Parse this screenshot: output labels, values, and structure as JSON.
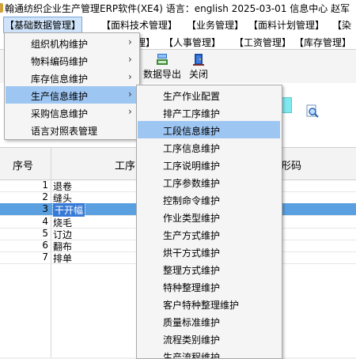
{
  "title": "翰通纺织企业生产管理ERP软件(XE4)  语言：english  2025-03-01  信息中心 赵军",
  "menu_row1": [
    {
      "label": "【基础数据管理】",
      "active": true
    },
    {
      "label": "【面料技术管理】",
      "active": false
    },
    {
      "label": "【业务管理】",
      "active": false
    },
    {
      "label": "【面料计划管理】",
      "active": false
    },
    {
      "label": "【染",
      "active": false
    }
  ],
  "menu_row2": [
    "理】",
    "【人事管理】",
    "【工资管理】",
    "【库存管理】"
  ],
  "toolbar": {
    "export_label": "数据导出",
    "close_label": "关闭"
  },
  "grid": {
    "headers": [
      "序号",
      "工序",
      "形码"
    ],
    "rows": [
      {
        "num": "1",
        "name": "退卷",
        "selected": false
      },
      {
        "num": "2",
        "name": "缝头",
        "selected": false
      },
      {
        "num": "3",
        "name": "干开幅",
        "selected": true
      },
      {
        "num": "4",
        "name": "烧毛",
        "selected": false
      },
      {
        "num": "5",
        "name": "订边",
        "selected": false
      },
      {
        "num": "6",
        "name": "翻布",
        "selected": false
      },
      {
        "num": "7",
        "name": "排单",
        "selected": false
      }
    ]
  },
  "dropdown_main": [
    {
      "label": "组织机构维护",
      "submenu": true,
      "highlight": false
    },
    {
      "label": "物料编码维护",
      "submenu": true,
      "highlight": false
    },
    {
      "label": "库存信息维护",
      "submenu": true,
      "highlight": false
    },
    {
      "label": "生产信息维护",
      "submenu": true,
      "highlight": true
    },
    {
      "label": "采购信息维护",
      "submenu": true,
      "highlight": false
    },
    {
      "label": "语言对照表管理",
      "submenu": false,
      "highlight": false
    }
  ],
  "dropdown_sub": [
    {
      "label": "生产作业配置",
      "highlight": false
    },
    {
      "label": "排产工序维护",
      "highlight": false
    },
    {
      "label": "工段信息维护",
      "highlight": true
    },
    {
      "label": "工序信息维护",
      "highlight": false
    },
    {
      "label": "工序说明维护",
      "highlight": false
    },
    {
      "label": "工序参数维护",
      "highlight": false
    },
    {
      "label": "控制命令维护",
      "highlight": false
    },
    {
      "label": "作业类型维护",
      "highlight": false
    },
    {
      "label": "生产方式维护",
      "highlight": false
    },
    {
      "label": "烘干方式维护",
      "highlight": false
    },
    {
      "label": "整理方式维护",
      "highlight": false
    },
    {
      "label": "特种整理维护",
      "highlight": false
    },
    {
      "label": "客户特种整理维护",
      "highlight": false
    },
    {
      "label": "质量标准维护",
      "highlight": false
    },
    {
      "label": "流程类别维护",
      "highlight": false
    },
    {
      "label": "生产流程维护",
      "highlight": false
    }
  ],
  "icons": {
    "export": "export-icon",
    "close": "close-door-icon",
    "search": "search-icon",
    "submenu_arrow": "chevron-right-icon"
  },
  "colors": {
    "highlight": "#9ec6f2",
    "selected_row": "#5aa0e0",
    "selected_cell": "#3779d6",
    "cyan_field": "#7fe9f0"
  }
}
